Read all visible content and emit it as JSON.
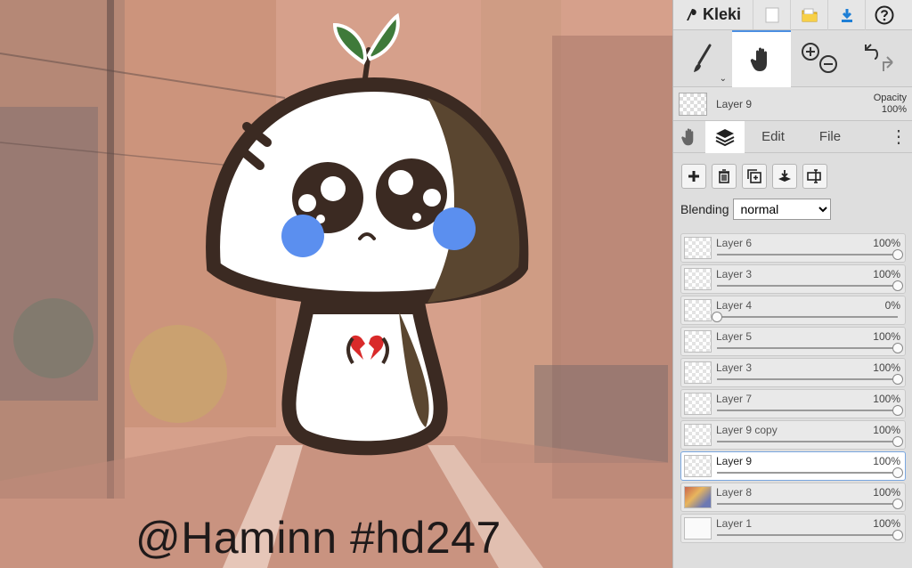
{
  "canvas": {
    "watermark": "@Haminn  #hd247"
  },
  "app": {
    "brand": "Kleki",
    "top_icons": [
      "new-image-icon",
      "open-folder-icon",
      "download-icon",
      "help-icon"
    ]
  },
  "tools": [
    {
      "name": "brush-tool",
      "icon": "brush-icon",
      "active": false
    },
    {
      "name": "hand-tool",
      "icon": "hand-icon",
      "active": true
    },
    {
      "name": "zoom-tool",
      "icon": "zoom-in-out-icon",
      "active": false
    },
    {
      "name": "undo-redo",
      "icon": "undo-redo-icon",
      "active": false
    }
  ],
  "current_layer": {
    "name": "Layer 9",
    "opacity_label": "Opacity",
    "opacity_value": "100%"
  },
  "tabs": {
    "edit": "Edit",
    "file": "File"
  },
  "blending": {
    "label": "Blending",
    "selected": "normal"
  },
  "layers": [
    {
      "name": "Layer 6",
      "opacity": "100%",
      "value": 1.0,
      "thumb": "checker"
    },
    {
      "name": "Layer 3",
      "opacity": "100%",
      "value": 1.0,
      "thumb": "checker"
    },
    {
      "name": "Layer 4",
      "opacity": "0%",
      "value": 0.0,
      "thumb": "checker"
    },
    {
      "name": "Layer 5",
      "opacity": "100%",
      "value": 1.0,
      "thumb": "checker"
    },
    {
      "name": "Layer 3",
      "opacity": "100%",
      "value": 1.0,
      "thumb": "checker"
    },
    {
      "name": "Layer 7",
      "opacity": "100%",
      "value": 1.0,
      "thumb": "checker"
    },
    {
      "name": "Layer 9 copy",
      "opacity": "100%",
      "value": 1.0,
      "thumb": "checker"
    },
    {
      "name": "Layer 9",
      "opacity": "100%",
      "value": 1.0,
      "thumb": "checker",
      "selected": true
    },
    {
      "name": "Layer 8",
      "opacity": "100%",
      "value": 1.0,
      "thumb": "pic"
    },
    {
      "name": "Layer 1",
      "opacity": "100%",
      "value": 1.0,
      "thumb": "plain"
    }
  ],
  "colors": {
    "accent": "#4b8fe2",
    "outline": "#3b2a22",
    "cheek": "#5b8fef",
    "sprout": "#3f7a3a",
    "heart": "#d92a2a"
  }
}
